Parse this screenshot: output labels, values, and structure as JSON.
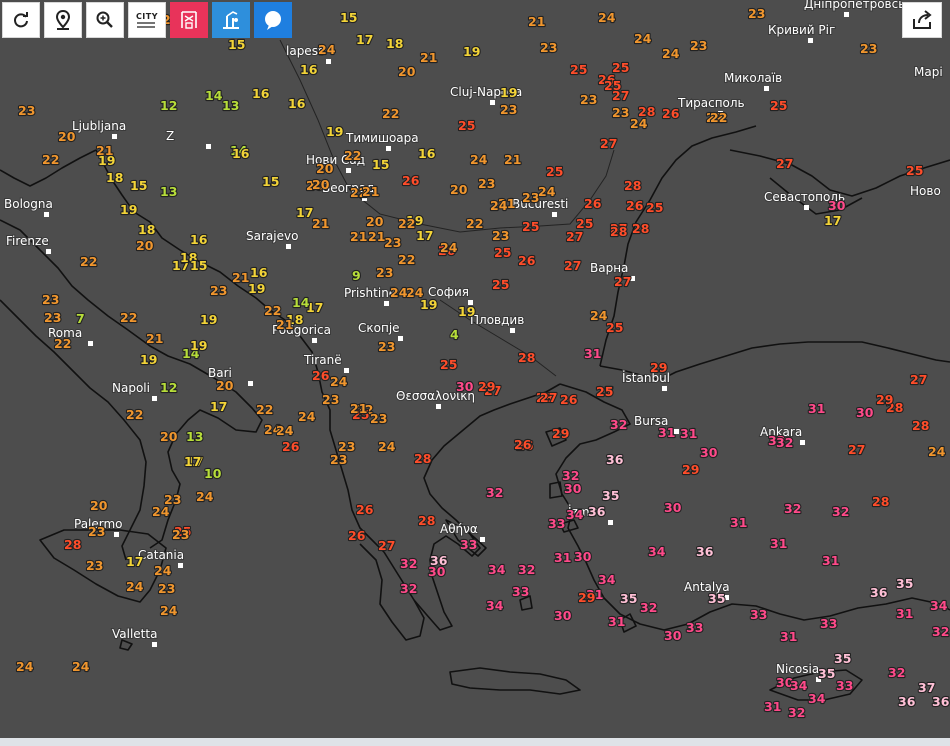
{
  "toolbar": {
    "city_button_label": "CITY",
    "buttons": [
      "refresh-icon",
      "location-pin-icon",
      "zoom-icon",
      "city-toggle",
      "wind-station-icon",
      "weather-station-icon",
      "chat-bubble-icon"
    ]
  },
  "share_button": "share-icon",
  "colors": {
    "background": "#4d4d4d",
    "coastline": "#111111",
    "temp_cool": "#b7dd3a",
    "temp_mild": "#f3d438",
    "temp_warm": "#f0962e",
    "temp_hot": "#ff4d2a",
    "temp_very_hot": "#ff4a8a",
    "temp_extreme": "#ffc0d6"
  },
  "cities": [
    {
      "id": "budapest",
      "name": "Budapest",
      "display": "lapest"
    },
    {
      "id": "ljubljana",
      "name": "Ljubljana",
      "display": "Ljubljana"
    },
    {
      "id": "zagreb",
      "name": "Zagreb",
      "display": "Z"
    },
    {
      "id": "bologna",
      "name": "Bologna",
      "display": "Bologna"
    },
    {
      "id": "firenze",
      "name": "Firenze",
      "display": "Firenze"
    },
    {
      "id": "sarajevo",
      "name": "Sarajevo",
      "display": "Sarajevo"
    },
    {
      "id": "beograd",
      "name": "Beograd",
      "display": "Београд"
    },
    {
      "id": "novi-sad",
      "name": "Novi Sad",
      "display": "Нови Сад"
    },
    {
      "id": "timisoara",
      "name": "Timisoara",
      "display": "Тимишоара"
    },
    {
      "id": "cluj",
      "name": "Cluj-Napoca",
      "display": "Cluj-Napoca"
    },
    {
      "id": "bucuresti",
      "name": "Bucuresti",
      "display": "Bucuresti"
    },
    {
      "id": "roma",
      "name": "Roma",
      "display": "Roma"
    },
    {
      "id": "napoli",
      "name": "Napoli",
      "display": "Napoli"
    },
    {
      "id": "bari",
      "name": "Bari",
      "display": "Bari"
    },
    {
      "id": "podgorica",
      "name": "Podgorica",
      "display": "Podgorica"
    },
    {
      "id": "pristina",
      "name": "Prishtine",
      "display": "Prishtinë"
    },
    {
      "id": "skopje",
      "name": "Skopje",
      "display": "Скопје"
    },
    {
      "id": "sofia",
      "name": "Sofia",
      "display": "София"
    },
    {
      "id": "plovdiv",
      "name": "Plovdiv",
      "display": "Пловдив"
    },
    {
      "id": "varna",
      "name": "Varna",
      "display": "Варна"
    },
    {
      "id": "tirane",
      "name": "Tirane",
      "display": "Tiranë"
    },
    {
      "id": "thessaloniki",
      "name": "Thessaloniki",
      "display": "Θεσσαλονίκη"
    },
    {
      "id": "athina",
      "name": "Athina",
      "display": "Αθήνα"
    },
    {
      "id": "istanbul",
      "name": "Istanbul",
      "display": "İstanbul"
    },
    {
      "id": "bursa",
      "name": "Bursa",
      "display": "Bursa"
    },
    {
      "id": "izmir",
      "name": "Izmir",
      "display": "İzmir"
    },
    {
      "id": "ankara",
      "name": "Ankara",
      "display": "Ankara"
    },
    {
      "id": "antalya",
      "name": "Antalya",
      "display": "Antalya"
    },
    {
      "id": "nicosia",
      "name": "Nicosia",
      "display": "Nicosia"
    },
    {
      "id": "palermo",
      "name": "Palermo",
      "display": "Palermo"
    },
    {
      "id": "catania",
      "name": "Catania",
      "display": "Catania"
    },
    {
      "id": "valletta",
      "name": "Valletta",
      "display": "Valletta"
    },
    {
      "id": "kryvyi-rih",
      "name": "Kryvyi Rih",
      "display": "Кривий Ріг"
    },
    {
      "id": "mykolaiv",
      "name": "Mykolaiv",
      "display": "Миколаїв"
    },
    {
      "id": "tiraspol",
      "name": "Tiraspol",
      "display": "Тирасполь"
    },
    {
      "id": "sevastopol",
      "name": "Sevastopol",
      "display": "Севастополь"
    },
    {
      "id": "dnipropetrovsk",
      "name": "Dnipropetrovsk",
      "display": "Дніпропетровсь"
    },
    {
      "id": "mariupol",
      "name": "Mariupol",
      "display": "Марі"
    },
    {
      "id": "novorossiysk",
      "name": "Novorossiysk",
      "display": "Ново"
    }
  ],
  "temperatures": [
    {
      "id": "t1",
      "value": 15
    },
    {
      "id": "t2",
      "value": 16
    },
    {
      "id": "t3",
      "value": 17
    },
    {
      "id": "t4",
      "value": 18
    },
    {
      "id": "t5",
      "value": 19
    },
    {
      "id": "t6",
      "value": 21
    },
    {
      "id": "t7",
      "value": 24
    },
    {
      "id": "t8",
      "value": 23
    },
    {
      "id": "t9",
      "value": 21
    },
    {
      "id": "t10",
      "value": 19
    },
    {
      "id": "t11",
      "value": 20
    },
    {
      "id": "t12",
      "value": 22
    },
    {
      "id": "t13",
      "value": 23
    },
    {
      "id": "t14",
      "value": 25
    },
    {
      "id": "t15",
      "value": 23
    },
    {
      "id": "t16",
      "value": 15
    },
    {
      "id": "t17",
      "value": 16
    },
    {
      "id": "t18",
      "value": 14
    },
    {
      "id": "t19",
      "value": 13
    },
    {
      "id": "t20",
      "value": 12
    },
    {
      "id": "t21",
      "value": 20
    },
    {
      "id": "t22",
      "value": 21
    },
    {
      "id": "t23",
      "value": 22
    },
    {
      "id": "t24",
      "value": 23
    },
    {
      "id": "t25",
      "value": 20
    },
    {
      "id": "t26",
      "value": 19
    },
    {
      "id": "t27",
      "value": 18
    },
    {
      "id": "t28",
      "value": 15
    },
    {
      "id": "t29",
      "value": 13
    },
    {
      "id": "t30",
      "value": 16
    },
    {
      "id": "t31",
      "value": 17
    },
    {
      "id": "t32",
      "value": 19
    },
    {
      "id": "t33",
      "value": 22
    },
    {
      "id": "t34",
      "value": 23
    },
    {
      "id": "t35",
      "value": 24
    },
    {
      "id": "t36",
      "value": 25
    },
    {
      "id": "t37",
      "value": 26
    },
    {
      "id": "t38",
      "value": 27
    },
    {
      "id": "t39",
      "value": 28
    },
    {
      "id": "t40",
      "value": 25
    },
    {
      "id": "t41",
      "value": 27
    },
    {
      "id": "t42",
      "value": 24
    },
    {
      "id": "t43",
      "value": 23
    },
    {
      "id": "t44",
      "value": 22
    },
    {
      "id": "t45",
      "value": 21
    },
    {
      "id": "t46",
      "value": 20
    },
    {
      "id": "t47",
      "value": 17
    },
    {
      "id": "t48",
      "value": 16
    },
    {
      "id": "t49",
      "value": 19
    },
    {
      "id": "t50",
      "value": 18
    },
    {
      "id": "t51",
      "value": 17
    },
    {
      "id": "t52",
      "value": 14
    },
    {
      "id": "t53",
      "value": 9
    },
    {
      "id": "t54",
      "value": 19
    },
    {
      "id": "t55",
      "value": 21
    },
    {
      "id": "t56",
      "value": 23
    },
    {
      "id": "t57",
      "value": 24
    },
    {
      "id": "t58",
      "value": 25
    },
    {
      "id": "t59",
      "value": 26
    },
    {
      "id": "t60",
      "value": 27
    },
    {
      "id": "t61",
      "value": 28
    },
    {
      "id": "t62",
      "value": 25
    },
    {
      "id": "t63",
      "value": 24
    },
    {
      "id": "t64",
      "value": 21
    },
    {
      "id": "t65",
      "value": 19
    },
    {
      "id": "t66",
      "value": 4
    },
    {
      "id": "t67",
      "value": 25
    },
    {
      "id": "t68",
      "value": 27
    },
    {
      "id": "t69",
      "value": 24
    },
    {
      "id": "t70",
      "value": 22
    },
    {
      "id": "t71",
      "value": 17
    },
    {
      "id": "t72",
      "value": 23
    },
    {
      "id": "t73",
      "value": 22
    },
    {
      "id": "t74",
      "value": 7
    },
    {
      "id": "t75",
      "value": 22
    },
    {
      "id": "t76",
      "value": 21
    },
    {
      "id": "t77",
      "value": 19
    },
    {
      "id": "t78",
      "value": 14
    },
    {
      "id": "t79",
      "value": 19
    },
    {
      "id": "t80",
      "value": 20
    },
    {
      "id": "t81",
      "value": 18
    },
    {
      "id": "t82",
      "value": 20
    },
    {
      "id": "t83",
      "value": 19
    },
    {
      "id": "t84",
      "value": 18
    },
    {
      "id": "t85",
      "value": 15
    },
    {
      "id": "t86",
      "value": 23
    },
    {
      "id": "t87",
      "value": 21
    },
    {
      "id": "t88",
      "value": 22
    },
    {
      "id": "t89",
      "value": 21
    },
    {
      "id": "t90",
      "value": 24
    },
    {
      "id": "t91",
      "value": 26
    },
    {
      "id": "t92",
      "value": 23
    },
    {
      "id": "t93",
      "value": 24
    },
    {
      "id": "t94",
      "value": 23
    },
    {
      "id": "t95",
      "value": 25
    },
    {
      "id": "t96",
      "value": 23
    },
    {
      "id": "t97",
      "value": 24
    },
    {
      "id": "t98",
      "value": 21
    },
    {
      "id": "t99",
      "value": 12
    },
    {
      "id": "t100",
      "value": 22
    },
    {
      "id": "t101",
      "value": 17
    },
    {
      "id": "t102",
      "value": 22
    },
    {
      "id": "t103",
      "value": 20
    },
    {
      "id": "t104",
      "value": 13
    },
    {
      "id": "t105",
      "value": 17
    },
    {
      "id": "t106",
      "value": 10
    },
    {
      "id": "t107",
      "value": 20
    },
    {
      "id": "t108",
      "value": 24
    },
    {
      "id": "t109",
      "value": 23
    },
    {
      "id": "t110",
      "value": 24
    },
    {
      "id": "t111",
      "value": 25
    },
    {
      "id": "t112",
      "value": 28
    },
    {
      "id": "t113",
      "value": 23
    },
    {
      "id": "t114",
      "value": 23
    },
    {
      "id": "t115",
      "value": 24
    },
    {
      "id": "t116",
      "value": 28
    },
    {
      "id": "t117",
      "value": 23
    },
    {
      "id": "t118",
      "value": 17
    },
    {
      "id": "t119",
      "value": 24
    },
    {
      "id": "t120",
      "value": 23
    },
    {
      "id": "t121",
      "value": 24
    },
    {
      "id": "t122",
      "value": 24
    },
    {
      "id": "t123",
      "value": 23
    },
    {
      "id": "t124",
      "value": 26
    },
    {
      "id": "t125",
      "value": 24
    },
    {
      "id": "t126",
      "value": 24
    },
    {
      "id": "t127",
      "value": 28
    },
    {
      "id": "t128",
      "value": 26
    },
    {
      "id": "t129",
      "value": 27
    },
    {
      "id": "t130",
      "value": 26
    },
    {
      "id": "t131",
      "value": 26
    },
    {
      "id": "t132",
      "value": 30
    },
    {
      "id": "t133",
      "value": 29
    },
    {
      "id": "t134",
      "value": 28
    },
    {
      "id": "t135",
      "value": 27
    },
    {
      "id": "t136",
      "value": 26
    },
    {
      "id": "t137",
      "value": 29
    },
    {
      "id": "t138",
      "value": 32
    },
    {
      "id": "t139",
      "value": 31
    },
    {
      "id": "t140",
      "value": 28
    },
    {
      "id": "t141",
      "value": 27
    },
    {
      "id": "t142",
      "value": 26
    },
    {
      "id": "t143",
      "value": 25
    },
    {
      "id": "t144",
      "value": 32
    },
    {
      "id": "t145",
      "value": 36
    },
    {
      "id": "t146",
      "value": 32
    },
    {
      "id": "t147",
      "value": 30
    },
    {
      "id": "t148",
      "value": 35
    },
    {
      "id": "t149",
      "value": 36
    },
    {
      "id": "t150",
      "value": 34
    },
    {
      "id": "t151",
      "value": 33
    },
    {
      "id": "t152",
      "value": 33
    },
    {
      "id": "t153",
      "value": 36
    },
    {
      "id": "t154",
      "value": 34
    },
    {
      "id": "t155",
      "value": 32
    },
    {
      "id": "t156",
      "value": 32
    },
    {
      "id": "t157",
      "value": 34
    },
    {
      "id": "t158",
      "value": 30
    },
    {
      "id": "t159",
      "value": 31
    },
    {
      "id": "t160",
      "value": 34
    },
    {
      "id": "t161",
      "value": 35
    },
    {
      "id": "t162",
      "value": 32
    },
    {
      "id": "t163",
      "value": 30
    },
    {
      "id": "t164",
      "value": 33
    },
    {
      "id": "t165",
      "value": 31
    },
    {
      "id": "t166",
      "value": 32
    },
    {
      "id": "t167",
      "value": 33
    },
    {
      "id": "t168",
      "value": 36
    },
    {
      "id": "t169",
      "value": 35
    },
    {
      "id": "t170",
      "value": 31
    },
    {
      "id": "t171",
      "value": 34
    },
    {
      "id": "t172",
      "value": 31
    },
    {
      "id": "t173",
      "value": 30
    },
    {
      "id": "t174",
      "value": 30
    },
    {
      "id": "t175",
      "value": 29
    },
    {
      "id": "t176",
      "value": 31
    },
    {
      "id": "t177",
      "value": 30
    },
    {
      "id": "t178",
      "value": 32
    },
    {
      "id": "t179",
      "value": 30
    },
    {
      "id": "t180",
      "value": 31
    },
    {
      "id": "t181",
      "value": 32
    },
    {
      "id": "t182",
      "value": 31
    },
    {
      "id": "t183",
      "value": 29
    },
    {
      "id": "t184",
      "value": 27
    },
    {
      "id": "t185",
      "value": 28
    },
    {
      "id": "t186",
      "value": 24
    },
    {
      "id": "t187",
      "value": 31
    },
    {
      "id": "t188",
      "value": 32
    },
    {
      "id": "t189",
      "value": 30
    },
    {
      "id": "t190",
      "value": 32
    },
    {
      "id": "t191",
      "value": 28
    },
    {
      "id": "t192",
      "value": 29
    },
    {
      "id": "t193",
      "value": 28
    },
    {
      "id": "t194",
      "value": 31
    },
    {
      "id": "t195",
      "value": 33
    },
    {
      "id": "t196",
      "value": 35
    },
    {
      "id": "t197",
      "value": 36
    },
    {
      "id": "t198",
      "value": 34
    },
    {
      "id": "t199",
      "value": 32
    },
    {
      "id": "t200",
      "value": 31
    },
    {
      "id": "t201",
      "value": 33
    },
    {
      "id": "t202",
      "value": 35
    },
    {
      "id": "t203",
      "value": 35
    },
    {
      "id": "t204",
      "value": 33
    },
    {
      "id": "t205",
      "value": 31
    },
    {
      "id": "t206",
      "value": 30
    },
    {
      "id": "t207",
      "value": 36
    },
    {
      "id": "t208",
      "value": 37
    },
    {
      "id": "t209",
      "value": 34
    },
    {
      "id": "t210",
      "value": 34
    },
    {
      "id": "t211",
      "value": 31
    },
    {
      "id": "t212",
      "value": 32
    },
    {
      "id": "t213",
      "value": 36
    },
    {
      "id": "t214",
      "value": 32
    },
    {
      "id": "t215",
      "value": 29
    },
    {
      "id": "t216",
      "value": 27
    },
    {
      "id": "t217",
      "value": 25
    },
    {
      "id": "t218",
      "value": 30
    },
    {
      "id": "t219",
      "value": 17
    },
    {
      "id": "t220",
      "value": 27
    },
    {
      "id": "t221",
      "value": 24
    },
    {
      "id": "t222",
      "value": 25
    },
    {
      "id": "t223",
      "value": 22
    },
    {
      "id": "t224",
      "value": 23
    },
    {
      "id": "t225",
      "value": 25
    },
    {
      "id": "t226",
      "value": 23
    },
    {
      "id": "t227",
      "value": 26
    },
    {
      "id": "t228",
      "value": 25
    },
    {
      "id": "t229",
      "value": 23
    },
    {
      "id": "t230",
      "value": 24
    },
    {
      "id": "t231",
      "value": 27
    },
    {
      "id": "t232",
      "value": 23
    },
    {
      "id": "t233",
      "value": 25
    },
    {
      "id": "t234",
      "value": 21
    },
    {
      "id": "t235",
      "value": 25
    },
    {
      "id": "t236",
      "value": 27
    },
    {
      "id": "t237",
      "value": 26
    },
    {
      "id": "t238",
      "value": 22
    },
    {
      "id": "t239",
      "value": 23
    },
    {
      "id": "t240",
      "value": 24
    },
    {
      "id": "t241",
      "value": 23
    },
    {
      "id": "t242",
      "value": 20
    },
    {
      "id": "t243",
      "value": 24
    },
    {
      "id": "t244",
      "value": 17
    },
    {
      "id": "t245",
      "value": 19
    },
    {
      "id": "t246",
      "value": 20
    },
    {
      "id": "t247",
      "value": 21
    },
    {
      "id": "t248",
      "value": 16
    },
    {
      "id": "t249",
      "value": 15
    },
    {
      "id": "t250",
      "value": 14
    },
    {
      "id": "t251",
      "value": 16
    },
    {
      "id": "t252",
      "value": 15
    },
    {
      "id": "t253",
      "value": 16
    },
    {
      "id": "t254",
      "value": 22
    },
    {
      "id": "t255",
      "value": 20
    },
    {
      "id": "t256",
      "value": 22
    },
    {
      "id": "t257",
      "value": 19
    },
    {
      "id": "t258",
      "value": 22
    },
    {
      "id": "t259",
      "value": 22
    },
    {
      "id": "t260",
      "value": 24
    },
    {
      "id": "t261",
      "value": 23
    },
    {
      "id": "t262",
      "value": 23
    },
    {
      "id": "t263",
      "value": 25
    },
    {
      "id": "t264",
      "value": 26
    },
    {
      "id": "t265",
      "value": 24
    },
    {
      "id": "t266",
      "value": 21
    },
    {
      "id": "t267",
      "value": 26
    },
    {
      "id": "t268",
      "value": 20
    },
    {
      "id": "t269",
      "value": 25
    },
    {
      "id": "t270",
      "value": 27
    },
    {
      "id": "t271",
      "value": 28
    },
    {
      "id": "t272",
      "value": 28
    },
    {
      "id": "t273",
      "value": 26
    },
    {
      "id": "t274",
      "value": 24
    }
  ]
}
